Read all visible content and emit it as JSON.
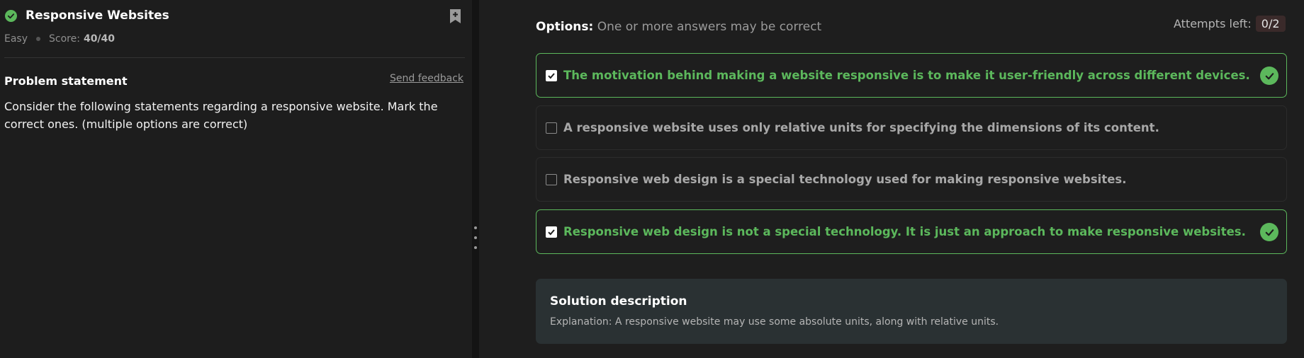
{
  "problem": {
    "title": "Responsive Websites",
    "difficulty": "Easy",
    "score_label": "Score:",
    "score_value": "40/40",
    "status": "solved"
  },
  "statement": {
    "heading": "Problem statement",
    "feedback_link": "Send feedback",
    "text": "Consider the following statements regarding a responsive website. Mark the correct ones. (multiple options are correct)"
  },
  "options_header": {
    "label": "Options:",
    "hint": "One or more answers may be correct"
  },
  "attempts": {
    "label": "Attempts left:",
    "value": "0/2"
  },
  "options": [
    {
      "text": "The motivation behind making a website responsive is to make it user-friendly across different devices.",
      "checked": true,
      "correct": true
    },
    {
      "text": "A responsive website uses only relative units for specifying the dimensions of its content.",
      "checked": false,
      "correct": false
    },
    {
      "text": "Responsive web design is a special technology used for making responsive websites.",
      "checked": false,
      "correct": false
    },
    {
      "text": "Responsive web design is not a special technology. It is just an approach to make responsive websites.",
      "checked": true,
      "correct": true
    }
  ],
  "solution": {
    "title": "Solution description",
    "text": "Explanation: A responsive website may use some absolute units, along with relative units."
  },
  "colors": {
    "accent_green": "#5cb85c",
    "background": "#1e1e1e",
    "solution_bg": "#2a3133"
  }
}
